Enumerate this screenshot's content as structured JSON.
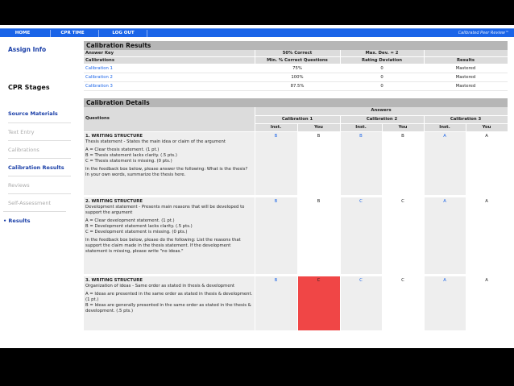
{
  "nav": {
    "home": "HOME",
    "cpr_time": "CPR TIME",
    "logout": "LOG OUT",
    "brand": "Calibrated Peer Review™"
  },
  "sidebar": {
    "assign_info": "Assign Info",
    "stages_title": "CPR Stages",
    "items": [
      {
        "label": "Source Materials"
      },
      {
        "label": "Text Entry"
      },
      {
        "label": "Calibrations"
      },
      {
        "label": "Calibration Results"
      },
      {
        "label": "Reviews"
      },
      {
        "label": "Self-Assessment"
      },
      {
        "label": "• Results"
      }
    ]
  },
  "calibration_results": {
    "title": "Calibration Results",
    "header1": {
      "answer_key": "Answer Key",
      "pct": "50% Correct",
      "maxdev": "Max. Dev. = 2"
    },
    "header2": {
      "calibrations": "Calibrations",
      "min": "Min. % Correct Questions",
      "rating": "Rating Deviation",
      "results": "Results"
    },
    "rows": [
      {
        "name": "Calibration 1",
        "pct": "75%",
        "dev": "0",
        "result": "Mastered"
      },
      {
        "name": "Calibration 2",
        "pct": "100%",
        "dev": "0",
        "result": "Mastered"
      },
      {
        "name": "Calibration 3",
        "pct": "87.5%",
        "dev": "0",
        "result": "Mastered"
      }
    ]
  },
  "calibration_details": {
    "title": "Calibration Details",
    "answers": "Answers",
    "questions": "Questions",
    "cal1": "Calibration 1",
    "cal2": "Calibration 2",
    "cal3": "Calibration 3",
    "inst": "Inst.",
    "you": "You",
    "q1": {
      "head": "1. WRITING STRUCTURE",
      "line1": "Thesis statement - States the main idea or claim of the argument",
      "a": "A = Clear thesis statement. (1 pt.)",
      "b": "B = Thesis statement lacks clarity. (.5 pts.)",
      "c": "C = Thesis statement is missing. (0 pts.)",
      "fb": "In the feedback box below, please answer the following: What is the thesis? In your own words, summarize the thesis here.",
      "answers": [
        "B",
        "B",
        "B",
        "B",
        "A",
        "A"
      ]
    },
    "q2": {
      "head": "2. WRITING STRUCTURE",
      "line1": "Development statement - Presents main reasons that will be developed to support the argument",
      "a": "A = Clear development statement. (1 pt.)",
      "b": "B = Development statement lacks clarity. (.5 pts.)",
      "c": "C = Development statement is missing. (0 pts.)",
      "fb": "In the feedback box below, please do the following: List the reasons that support the claim made in the thesis statement. If the development statement is missing, please write \"no ideas.\"",
      "answers": [
        "B",
        "B",
        "C",
        "C",
        "A",
        "A"
      ]
    },
    "q3": {
      "head": "3. WRITING STRUCTURE",
      "line1": "Organization of ideas - Same order as stated in thesis & development",
      "a": "A = Ideas are presented in the same order as stated in thesis & development. (1 pt.)",
      "b": "B = Ideas are generally presented in the same order as stated in the thesis & development. (.5 pts.)",
      "answers": [
        "B",
        "C",
        "C",
        "C",
        "A",
        "A"
      ]
    }
  }
}
